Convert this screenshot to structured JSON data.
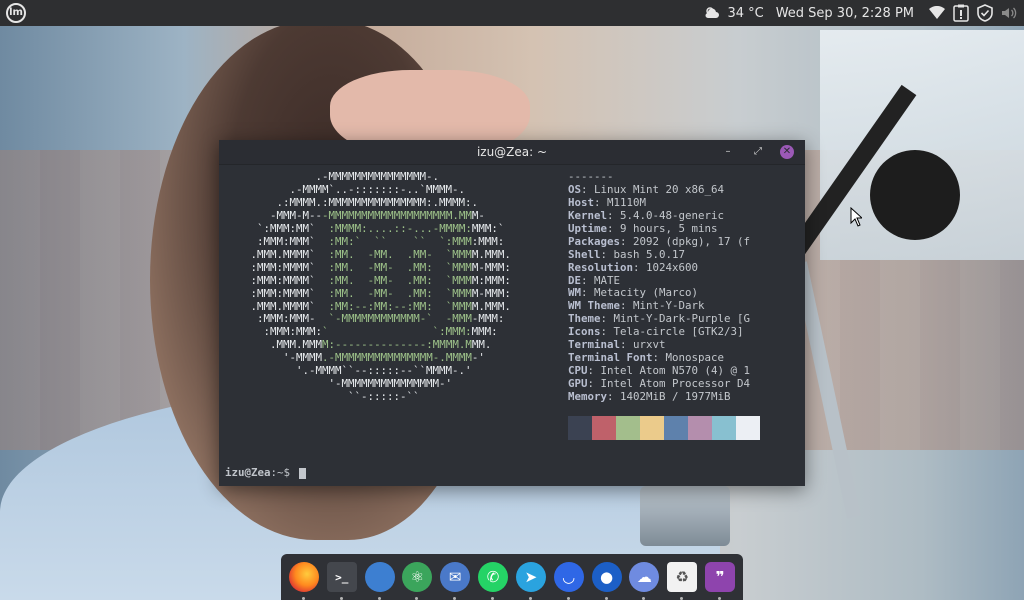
{
  "panel": {
    "menu_icon": "linux-mint-logo",
    "weather": "34 °C",
    "clock": "Wed Sep 30,  2:28 PM",
    "tray_icons": [
      "weather-icon",
      "wifi-icon",
      "update-manager-icon",
      "shield-icon",
      "volume-icon"
    ]
  },
  "terminal": {
    "title": "izu@Zea: ~",
    "logo": [
      "             .-MMMMMMMMMMMMMMM-.",
      "         .-MMMM`..-:::::::-..`MMMM-.",
      "       .:MMMM.:MMMMMMMMMMMMMMM:.MMMM:.",
      "      -MMM-M---MMMMMMMMMMMMMMMMMMM.MMM-",
      "    `:MMM:MM`  :MMMM:....::-...-MMMM:MMM:`",
      "    :MMM:MMM`  :MM:`  ``    ``  `:MMM:MMM:",
      "   .MMM.MMMM`  :MM.  -MM.  .MM-  `MMMM.MMM.",
      "   :MMM:MMMM`  :MM.  -MM-  .MM:  `MMMM-MMM:",
      "   :MMM:MMMM`  :MM.  -MM-  .MM:  `MMMM:MMM:",
      "   :MMM:MMMM`  :MM.  -MM-  .MM:  `MMMM-MMM:",
      "   .MMM.MMMM`  :MM:--:MM:--:MM:  `MMMM.MMM.",
      "    :MMM:MMM-  `-MMMMMMMMMMMM-`  -MMM-MMM:",
      "     :MMM:MMM:`                `:MMM:MMM:",
      "      .MMM.MMMM:--------------:MMMM.MMM.",
      "        '-MMMM.-MMMMMMMMMMMMMMM-.MMMM-'",
      "          '.-MMMM``--:::::--``MMMM-.'",
      "               '-MMMMMMMMMMMMMMM-'",
      "                  ``-:::::-``"
    ],
    "info": {
      "separator": "-------",
      "rows": [
        {
          "key": "OS",
          "value": "Linux Mint 20 x86_64"
        },
        {
          "key": "Host",
          "value": "M1110M"
        },
        {
          "key": "Kernel",
          "value": "5.4.0-48-generic"
        },
        {
          "key": "Uptime",
          "value": "9 hours, 5 mins"
        },
        {
          "key": "Packages",
          "value": "2092 (dpkg), 17 (f"
        },
        {
          "key": "Shell",
          "value": "bash 5.0.17"
        },
        {
          "key": "Resolution",
          "value": "1024x600"
        },
        {
          "key": "DE",
          "value": "MATE"
        },
        {
          "key": "WM",
          "value": "Metacity (Marco)"
        },
        {
          "key": "WM Theme",
          "value": "Mint-Y-Dark"
        },
        {
          "key": "Theme",
          "value": "Mint-Y-Dark-Purple [G"
        },
        {
          "key": "Icons",
          "value": "Tela-circle [GTK2/3]"
        },
        {
          "key": "Terminal",
          "value": "urxvt"
        },
        {
          "key": "Terminal Font",
          "value": "Monospace"
        },
        {
          "key": "CPU",
          "value": "Intel Atom N570 (4) @ 1"
        },
        {
          "key": "GPU",
          "value": "Intel Atom Processor D4"
        },
        {
          "key": "Memory",
          "value": "1402MiB / 1977MiB"
        }
      ]
    },
    "palette": [
      "#3b4252",
      "#bf616a",
      "#a3be8c",
      "#ebcb8b",
      "#5e81ac",
      "#b48ead",
      "#88c0d0",
      "#eceff4"
    ],
    "prompt_user": "izu@Zea",
    "prompt_rest": ":~$ "
  },
  "dock": {
    "apps": [
      {
        "name": "firefox-icon",
        "glyph": "",
        "bg": "#e66000"
      },
      {
        "name": "terminal-icon",
        "glyph": ">_",
        "bg": "#44474d"
      },
      {
        "name": "files-icon",
        "glyph": "",
        "bg": "#3d7fd1"
      },
      {
        "name": "atom-icon",
        "glyph": "⚛",
        "bg": "#3ba55c"
      },
      {
        "name": "thunderbird-icon",
        "glyph": "✉",
        "bg": "#4a79c9"
      },
      {
        "name": "whatsapp-icon",
        "glyph": "✆",
        "bg": "#25d366"
      },
      {
        "name": "telegram-icon",
        "glyph": "➤",
        "bg": "#2aa3df"
      },
      {
        "name": "app-store-icon",
        "glyph": "◡",
        "bg": "#2f67e6"
      },
      {
        "name": "toggle-app-icon",
        "glyph": "●",
        "bg": "#1c5fc7"
      },
      {
        "name": "weather-app-icon",
        "glyph": "☁",
        "bg": "#6f8be0"
      },
      {
        "name": "trash-icon",
        "glyph": "♻",
        "bg": "#f2f2f2"
      },
      {
        "name": "quote-app-icon",
        "glyph": "❞",
        "bg": "#8e44ad"
      }
    ]
  }
}
